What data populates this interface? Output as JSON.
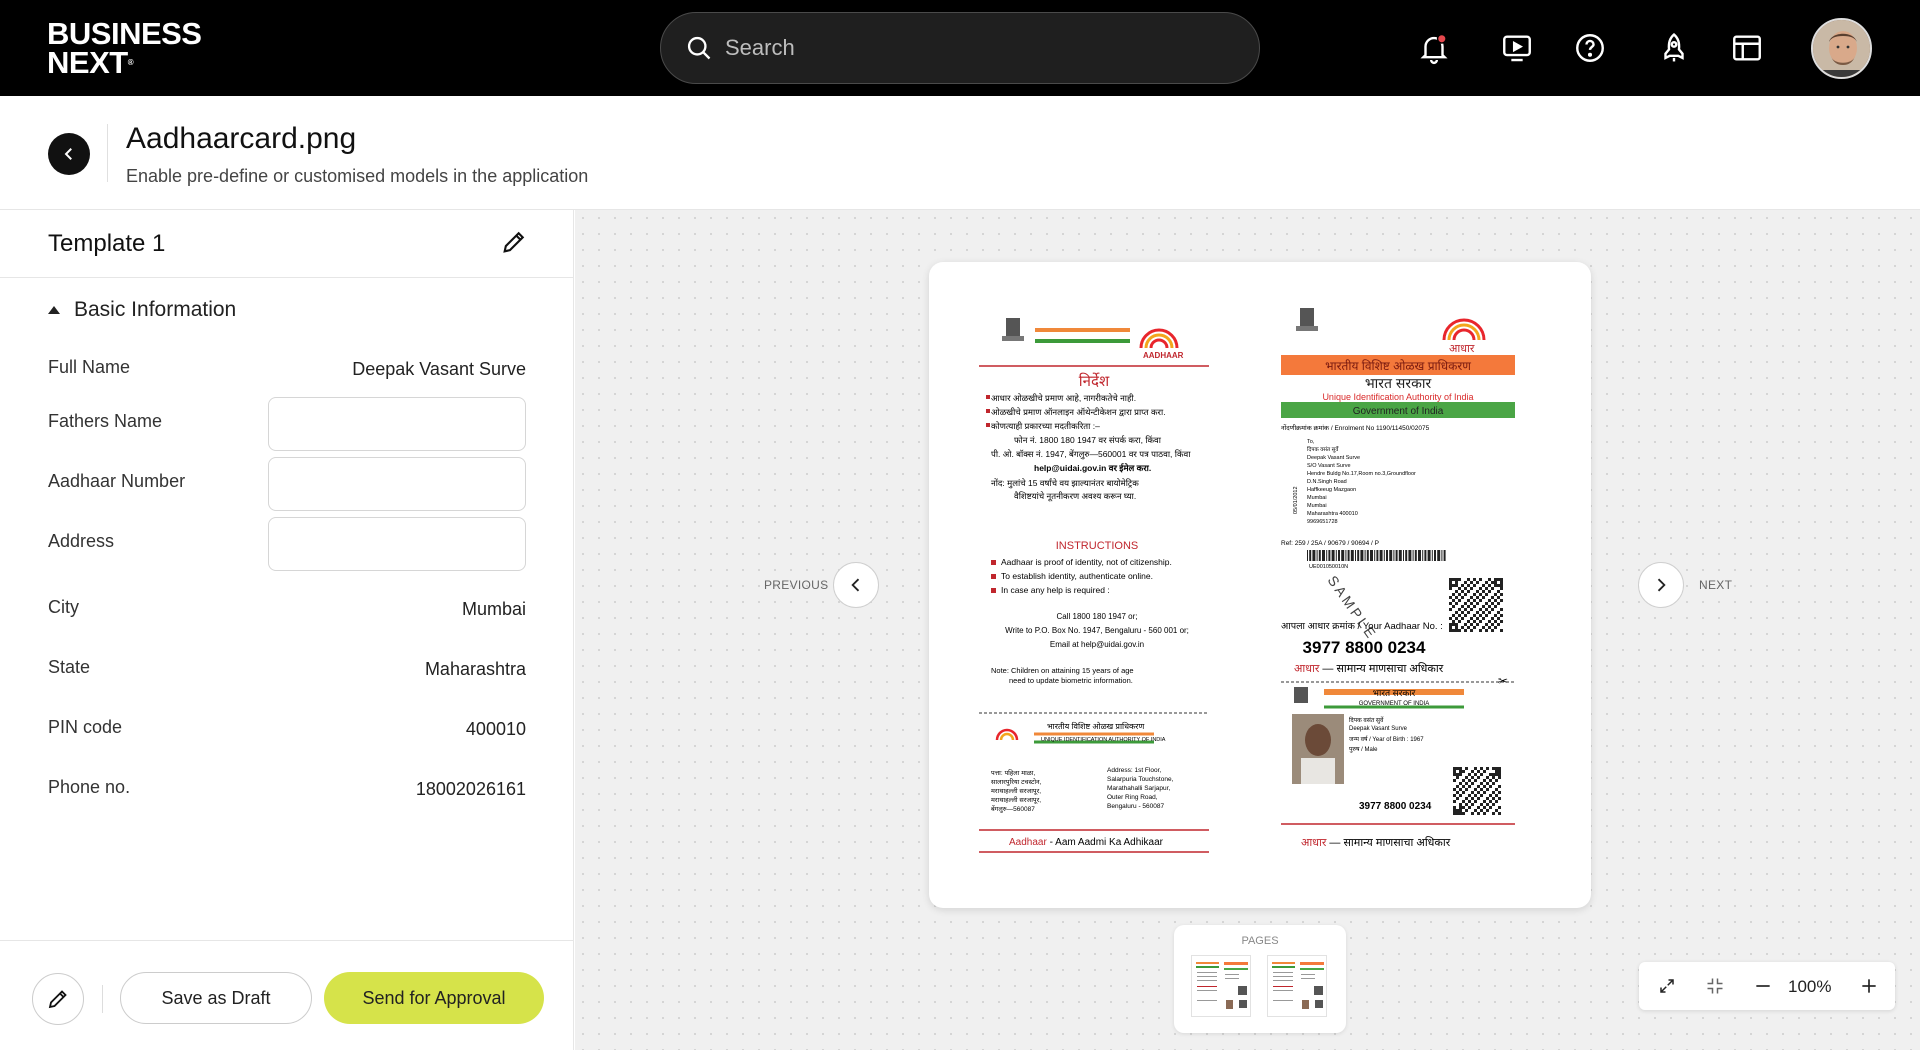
{
  "topbar": {
    "logo_line1": "BUSINESS",
    "logo_line2": "NEXT",
    "search_placeholder": "Search",
    "icons": [
      "bell-icon",
      "play-screen-icon",
      "help-icon",
      "rocket-icon",
      "layout-icon"
    ],
    "notification_dot_color": "#e5484d"
  },
  "header": {
    "title": "Aadhaarcard.png",
    "subtitle": "Enable pre-define or customised models in the application"
  },
  "template": {
    "title": "Template 1",
    "section_title": "Basic Information",
    "fields": [
      {
        "label": "Full Name",
        "value": "Deepak Vasant Surve"
      },
      {
        "label": "Fathers Name",
        "value": ""
      },
      {
        "label": "Aadhaar Number",
        "value": ""
      },
      {
        "label": "Address",
        "value": ""
      },
      {
        "label": "City",
        "value": "Mumbai"
      },
      {
        "label": "State",
        "value": "Maharashtra"
      },
      {
        "label": "PIN code",
        "value": "400010"
      },
      {
        "label": "Phone no.",
        "value": "18002026161"
      }
    ]
  },
  "footer": {
    "draft_label": "Save as Draft",
    "approve_label": "Send for Approval",
    "approve_color": "#d6e34a"
  },
  "viewer": {
    "previous_label": "PREVIOUS",
    "next_label": "NEXT",
    "pages_label": "PAGES",
    "zoom_level": "100%"
  },
  "document": {
    "left": {
      "brand": "AADHAAR",
      "heading_marathi": "निर्देश",
      "marathi_lines": [
        "आधार ओळखीचे प्रमाण आहे, नागरीकतेचे नाही.",
        "ओळखीचे प्रमाण ऑनलाइन ऑथेन्टीकेशन द्वारा प्राप्त करा.",
        "कोणत्याही प्रकारच्या मदतीकरिता :–",
        "फोन नं. 1800 180 1947 वर संपर्क करा, किंवा",
        "पी. ओ. बॉक्स नं. 1947, बेंगलुरु—560001 वर पत्र पाठवा, किंवा",
        "help@uidai.gov.in वर ईमेल करा.",
        "नोंद: मुलांचे 15 वर्षांचे वय झाल्यानंतर बायोमेट्रिक",
        "वैशिष्टयांचे नूतनीकरण अवश्य करून घ्या."
      ],
      "instructions_title": "INSTRUCTIONS",
      "instructions": [
        "Aadhaar is proof of identity, not of citizenship.",
        "To establish identity, authenticate online.",
        "In case any help is required :"
      ],
      "contact_lines": [
        "Call 1800 180 1947 or;",
        "Write to P.O. Box No. 1947, Bengaluru - 560 001 or;",
        "Email at help@uidai.gov.in"
      ],
      "note_lines": [
        "Note: Children on attaining 15 years of age",
        "need to update biometric information."
      ],
      "authority_marathi": "भारतीय विशिष्ट ओळख प्राधिकरण",
      "authority_english": "UNIQUE IDENTIFICATION AUTHORITY OF INDIA",
      "address_marathi": [
        "पत्ता: पहिला माळा,",
        "सालारपुरिया टचस्टोन,",
        "मराथाहल्ली सरजापूर,",
        "मराथाहल्ली सरजापूर,",
        "बेंगलुरु—560087"
      ],
      "address_english": [
        "Address: 1st Floor,",
        "Salarpuria Touchstone,",
        "Marathahalli Sarjapur,",
        "Outer Ring Road,",
        "Bengaluru - 560087"
      ],
      "tagline_prefix": "Aadhaar",
      "tagline_rest": " - Aam Aadmi Ka Adhikaar"
    },
    "right": {
      "brand": "आधार",
      "authority_marathi": "भारतीय विशिष्ट ओळख प्राधिकरण",
      "gov_marathi": "भारत सरकार",
      "uid_english": "Unique Identification Authority of India",
      "gov_english": "Government of India",
      "enrolment": "नोंदणीक्रमांक क्रमांक / Enrolment No 1190/11450/02075",
      "address_lines": [
        "To,",
        "दिपक वसंत सुर्वे",
        "Deepak Vasant Surve",
        "S/O Vasant Surve",
        "Hendre Buldg No.17,Room no.3,Groundfloor",
        "D.N.Singh Road",
        "Haffkeeug Mazgaon",
        "Mumbai",
        "Mumbai",
        "Maharashtra 400010",
        "9969651728"
      ],
      "side_date": "05/01/2012",
      "ref": "Ref: 259 / 25A / 90679 / 90694 / P",
      "barcode_text": "UE001050010N",
      "watermark": "SAMPLE",
      "your_no_label_marathi": "आपला आधार क्रमांक",
      "your_no_label_english": "Your Aadhaar No. :",
      "aadhaar_number": "3977 8800 0234",
      "tagline_prefix": "आधार",
      "tagline_rest": " — सामान्य माणसाचा अधिकार",
      "card_gov_marathi": "भारत सरकार",
      "card_gov_english": "GOVERNMENT OF INDIA",
      "card_lines": [
        "दिपक वसंत सुर्वे",
        "Deepak Vasant Surve",
        "जन्म वर्ष / Year of Birth : 1967",
        "पुरुष / Male"
      ],
      "card_number": "3977 8800 0234"
    }
  }
}
